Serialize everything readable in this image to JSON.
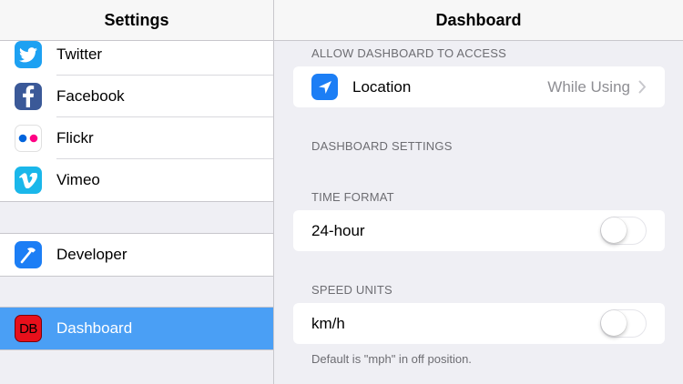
{
  "sidebar": {
    "title": "Settings",
    "social_items": [
      {
        "label": "Twitter",
        "icon": "twitter-icon"
      },
      {
        "label": "Facebook",
        "icon": "facebook-icon"
      },
      {
        "label": "Flickr",
        "icon": "flickr-icon"
      },
      {
        "label": "Vimeo",
        "icon": "vimeo-icon"
      }
    ],
    "developer": {
      "label": "Developer",
      "icon": "hammer-icon"
    },
    "dashboard": {
      "label": "Dashboard",
      "icon_text": "DB",
      "selected": true
    }
  },
  "main": {
    "title": "Dashboard",
    "access_header": "ALLOW DASHBOARD TO ACCESS",
    "location": {
      "label": "Location",
      "value": "While Using",
      "icon": "location-arrow-icon"
    },
    "settings_header": "DASHBOARD SETTINGS",
    "time_header": "TIME FORMAT",
    "time_toggle": {
      "label": "24-hour",
      "on": false
    },
    "speed_header": "SPEED UNITS",
    "speed_toggle": {
      "label": "km/h",
      "on": false
    },
    "speed_footnote": "Default is \"mph\" in off position."
  },
  "colors": {
    "selection": "#4a9ff5",
    "background": "#efeff4",
    "twitter": "#1da1f2",
    "facebook": "#3b5998",
    "vimeo": "#1ab7ea",
    "developer": "#1c7ef5",
    "dashboard": "#e8101b"
  }
}
